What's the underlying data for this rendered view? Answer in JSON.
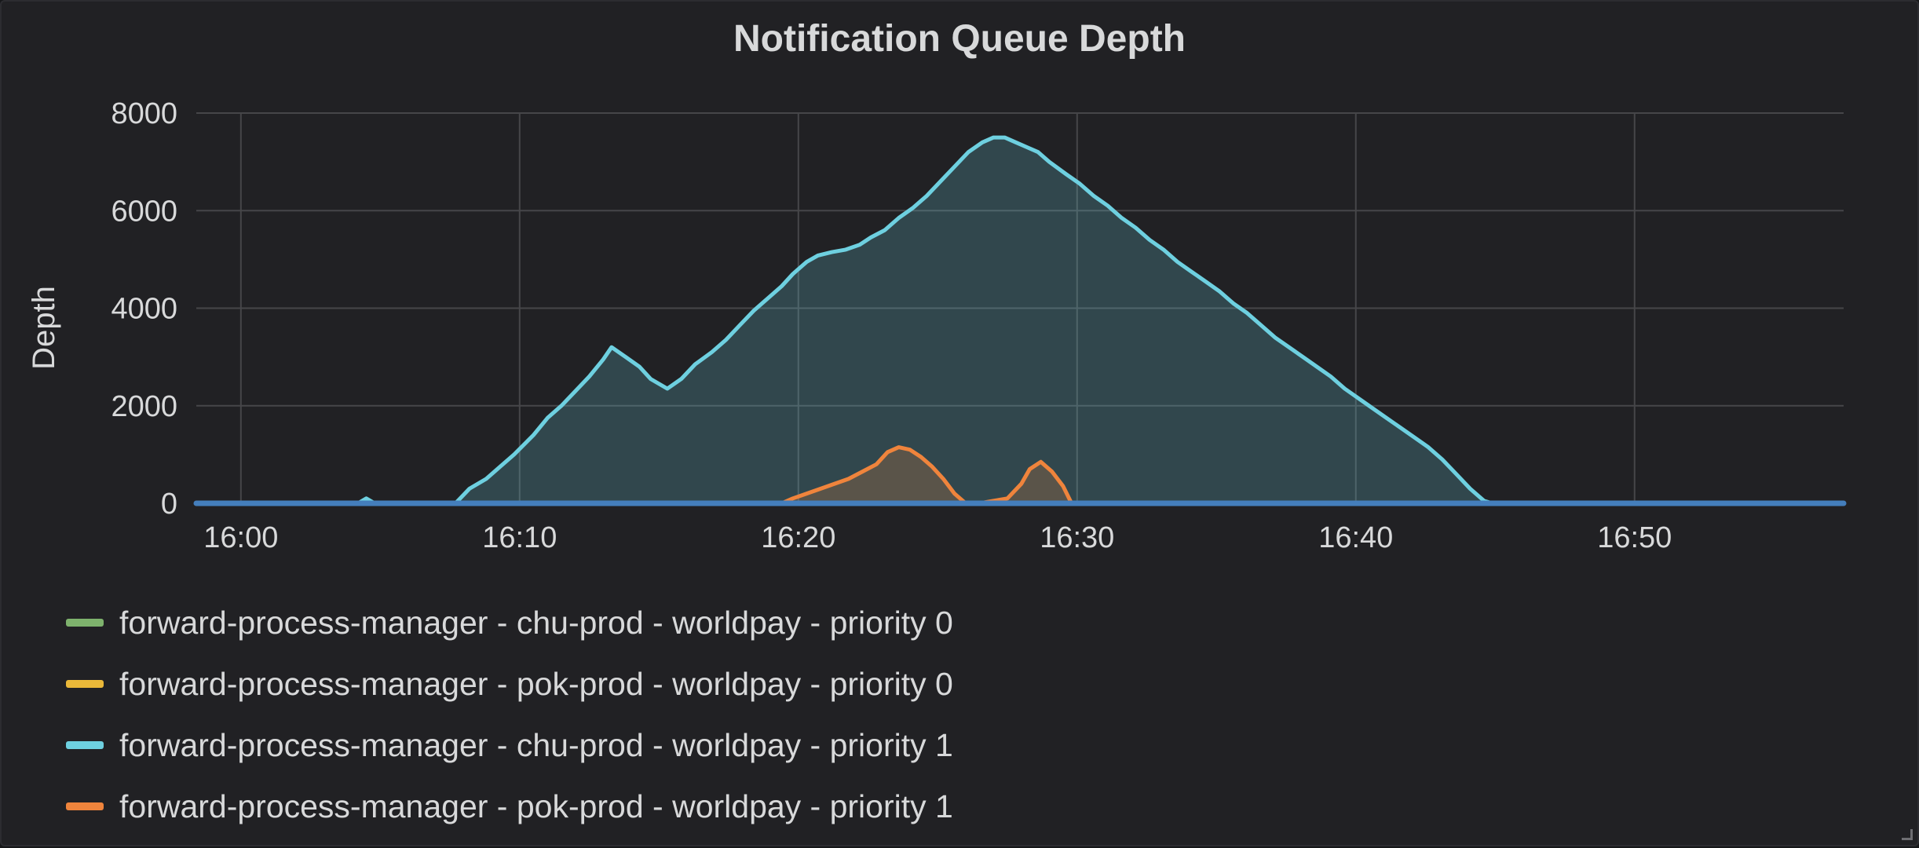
{
  "chart_data": {
    "type": "area",
    "title": "Notification Queue Depth",
    "ylabel": "Depth",
    "xlabel": "",
    "x_ticks": [
      "16:00",
      "16:10",
      "16:20",
      "16:30",
      "16:40",
      "16:50"
    ],
    "y_ticks": [
      0,
      2000,
      4000,
      6000,
      8000
    ],
    "ylim": [
      0,
      8000
    ],
    "xlim_minutes": [
      -1.6,
      57.5
    ],
    "x_unit": "minutes after 16:00",
    "grid": true,
    "legend_position": "bottom-left",
    "series": [
      {
        "name": "forward-process-manager - chu-prod - worldpay - priority 0",
        "color": "#7eb26d",
        "points": [
          [
            -1.6,
            0
          ],
          [
            57.5,
            0
          ]
        ]
      },
      {
        "name": "forward-process-manager - pok-prod - worldpay - priority 0",
        "color": "#eab839",
        "points": [
          [
            -1.6,
            0
          ],
          [
            57.5,
            0
          ]
        ]
      },
      {
        "name": "forward-process-manager - chu-prod - worldpay - priority 1",
        "color": "#6ed0e0",
        "points": [
          [
            -1.6,
            0
          ],
          [
            4.2,
            0
          ],
          [
            4.5,
            100
          ],
          [
            4.8,
            0
          ],
          [
            7.7,
            0
          ],
          [
            8.2,
            300
          ],
          [
            8.8,
            500
          ],
          [
            9.3,
            750
          ],
          [
            9.8,
            1000
          ],
          [
            10.5,
            1400
          ],
          [
            11.0,
            1750
          ],
          [
            11.5,
            2000
          ],
          [
            12.0,
            2300
          ],
          [
            12.5,
            2600
          ],
          [
            13.0,
            2950
          ],
          [
            13.3,
            3200
          ],
          [
            13.8,
            3000
          ],
          [
            14.3,
            2800
          ],
          [
            14.7,
            2550
          ],
          [
            15.3,
            2350
          ],
          [
            15.8,
            2550
          ],
          [
            16.3,
            2850
          ],
          [
            16.9,
            3100
          ],
          [
            17.4,
            3350
          ],
          [
            17.9,
            3650
          ],
          [
            18.4,
            3950
          ],
          [
            18.9,
            4200
          ],
          [
            19.4,
            4450
          ],
          [
            19.8,
            4700
          ],
          [
            20.3,
            4950
          ],
          [
            20.7,
            5080
          ],
          [
            21.2,
            5150
          ],
          [
            21.7,
            5200
          ],
          [
            22.2,
            5300
          ],
          [
            22.6,
            5450
          ],
          [
            23.1,
            5600
          ],
          [
            23.6,
            5850
          ],
          [
            24.1,
            6050
          ],
          [
            24.6,
            6300
          ],
          [
            25.1,
            6600
          ],
          [
            25.6,
            6900
          ],
          [
            26.1,
            7200
          ],
          [
            26.6,
            7400
          ],
          [
            27.0,
            7500
          ],
          [
            27.4,
            7500
          ],
          [
            27.8,
            7400
          ],
          [
            28.2,
            7300
          ],
          [
            28.6,
            7200
          ],
          [
            29.0,
            7000
          ],
          [
            29.6,
            6750
          ],
          [
            30.1,
            6550
          ],
          [
            30.6,
            6300
          ],
          [
            31.1,
            6100
          ],
          [
            31.6,
            5850
          ],
          [
            32.1,
            5650
          ],
          [
            32.6,
            5400
          ],
          [
            33.1,
            5200
          ],
          [
            33.6,
            4950
          ],
          [
            34.1,
            4750
          ],
          [
            34.6,
            4550
          ],
          [
            35.1,
            4350
          ],
          [
            35.6,
            4100
          ],
          [
            36.1,
            3900
          ],
          [
            36.6,
            3650
          ],
          [
            37.1,
            3400
          ],
          [
            37.6,
            3200
          ],
          [
            38.1,
            3000
          ],
          [
            38.6,
            2800
          ],
          [
            39.1,
            2600
          ],
          [
            39.6,
            2350
          ],
          [
            40.1,
            2150
          ],
          [
            40.6,
            1950
          ],
          [
            41.1,
            1750
          ],
          [
            41.6,
            1550
          ],
          [
            42.1,
            1350
          ],
          [
            42.6,
            1150
          ],
          [
            43.1,
            900
          ],
          [
            43.6,
            600
          ],
          [
            44.1,
            300
          ],
          [
            44.6,
            50
          ],
          [
            44.9,
            0
          ],
          [
            57.5,
            0
          ]
        ]
      },
      {
        "name": "forward-process-manager - pok-prod - worldpay - priority 1",
        "color": "#ef843c",
        "points": [
          [
            -1.6,
            0
          ],
          [
            19.4,
            0
          ],
          [
            19.8,
            100
          ],
          [
            20.3,
            200
          ],
          [
            20.8,
            300
          ],
          [
            21.3,
            400
          ],
          [
            21.8,
            500
          ],
          [
            22.3,
            650
          ],
          [
            22.8,
            800
          ],
          [
            23.2,
            1050
          ],
          [
            23.6,
            1150
          ],
          [
            24.0,
            1100
          ],
          [
            24.4,
            950
          ],
          [
            24.8,
            750
          ],
          [
            25.2,
            500
          ],
          [
            25.6,
            200
          ],
          [
            26.0,
            0
          ],
          [
            26.5,
            0
          ],
          [
            27.0,
            50
          ],
          [
            27.5,
            100
          ],
          [
            28.0,
            400
          ],
          [
            28.3,
            700
          ],
          [
            28.7,
            850
          ],
          [
            29.1,
            650
          ],
          [
            29.5,
            350
          ],
          [
            29.8,
            0
          ],
          [
            57.5,
            0
          ]
        ]
      },
      {
        "name": "",
        "color": "#447ebc",
        "points": [
          [
            -1.6,
            0
          ],
          [
            57.5,
            0
          ]
        ]
      }
    ]
  }
}
